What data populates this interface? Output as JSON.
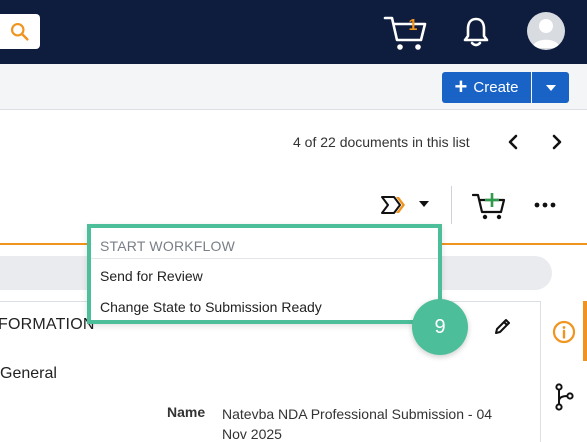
{
  "header": {
    "cart_count": "1"
  },
  "toolbar": {
    "create_label": "Create"
  },
  "pager": {
    "text": "4 of 22 documents in this list"
  },
  "workflow_menu": {
    "header": "START WORKFLOW",
    "items": [
      {
        "label": "Send for Review"
      },
      {
        "label": "Change State to Submission Ready"
      }
    ]
  },
  "details": {
    "section_title": "FORMATION",
    "group_label": "General",
    "name_label": "Name",
    "name_value": "Natevba NDA Professional Submission - 04 Nov 2025"
  },
  "step_badge": "9",
  "colors": {
    "nav_bg": "#0e1c3d",
    "primary_blue": "#1a63c6",
    "accent_orange": "#f0941e",
    "highlight_green": "#4cbf9a"
  },
  "icons": {
    "search": "search-icon",
    "cart": "cart-icon",
    "bell": "bell-icon",
    "avatar": "avatar-icon",
    "workflow": "workflow-icon",
    "add_to_cart": "add-to-cart-icon",
    "more": "more-icon",
    "edit": "pencil-icon",
    "info": "info-icon",
    "branch": "branch-icon"
  }
}
